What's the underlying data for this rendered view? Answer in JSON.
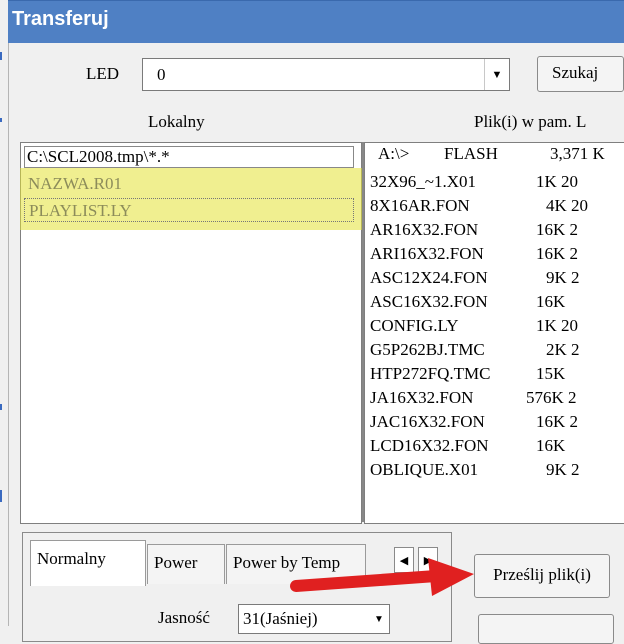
{
  "window": {
    "title": "Transferuj"
  },
  "led": {
    "label": "LED",
    "value": "0",
    "search_label": "Szukaj"
  },
  "local": {
    "header": "Lokalny",
    "path": "C:\\SCL2008.tmp\\*.*",
    "files": [
      "NAZWA.R01",
      "PLAYLIST.LY"
    ]
  },
  "memory": {
    "header": "Plik(i) w pam. L",
    "drive": "A:\\>",
    "type": "FLASH",
    "free": "3,371 K",
    "files": [
      {
        "name": "32X96_~1.X01",
        "size": "1K  20"
      },
      {
        "name": "8X16AR.FON",
        "size": "4K  20"
      },
      {
        "name": "AR16X32.FON",
        "size": "16K  2"
      },
      {
        "name": "ARI16X32.FON",
        "size": "16K  2"
      },
      {
        "name": "ASC12X24.FON",
        "size": "9K  2"
      },
      {
        "name": "ASC16X32.FON",
        "size": "16K"
      },
      {
        "name": "CONFIG.LY",
        "size": "1K  20"
      },
      {
        "name": "G5P262BJ.TMC",
        "size": "2K  2"
      },
      {
        "name": "HTP272FQ.TMC",
        "size": "15K"
      },
      {
        "name": "JA16X32.FON",
        "size": "576K  2"
      },
      {
        "name": "JAC16X32.FON",
        "size": "16K  2"
      },
      {
        "name": "LCD16X32.FON",
        "size": "16K"
      },
      {
        "name": "OBLIQUE.X01",
        "size": "9K  2"
      }
    ]
  },
  "tabs": [
    "Normalny",
    "Power",
    "Power by Temp"
  ],
  "brightness": {
    "label": "Jasność",
    "value": "31(Jaśniej)"
  },
  "send_button": "Prześlij plik(i)",
  "icons": {
    "dropdown": "chevron-down-icon",
    "prev": "triangle-left-icon",
    "next": "triangle-right-icon",
    "annotation": "red-arrow-icon"
  },
  "colors": {
    "title_bar": "#4f80c4",
    "highlight": "#e4e234",
    "arrow": "#e02020"
  }
}
